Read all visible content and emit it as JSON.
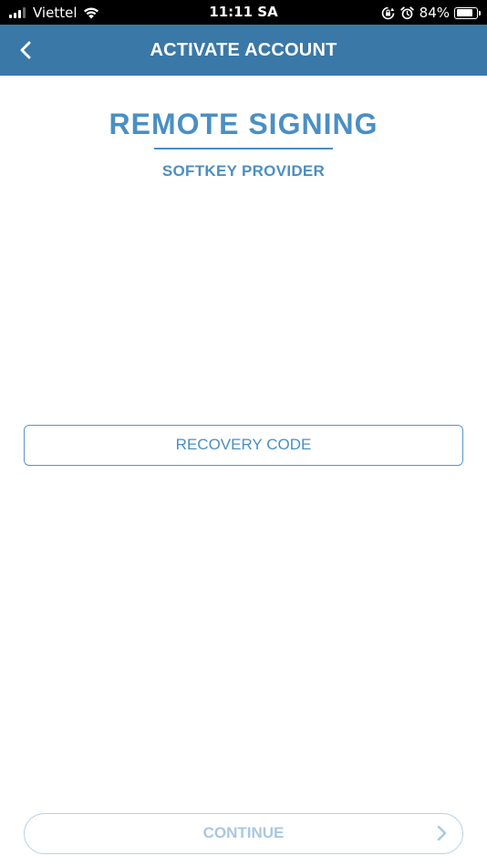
{
  "status_bar": {
    "carrier": "Viettel",
    "time": "11:11 SA",
    "battery_percent": "84%",
    "battery_level": 0.84,
    "icons": [
      "signal-icon",
      "wifi-icon",
      "orientation-lock-icon",
      "alarm-icon",
      "battery-icon"
    ]
  },
  "nav": {
    "back_icon": "chevron-left-icon",
    "title": "ACTIVATE ACCOUNT"
  },
  "heading": {
    "title": "REMOTE SIGNING",
    "subtitle": "SOFTKEY PROVIDER"
  },
  "recovery": {
    "label": "RECOVERY CODE"
  },
  "footer": {
    "continue_label": "CONTINUE",
    "continue_icon": "chevron-right-icon",
    "enabled": false
  },
  "colors": {
    "nav_background": "#3a78a7",
    "accent": "#4a8fc4",
    "disabled_text": "#a8c8e0",
    "disabled_border": "#b9d3e6"
  }
}
